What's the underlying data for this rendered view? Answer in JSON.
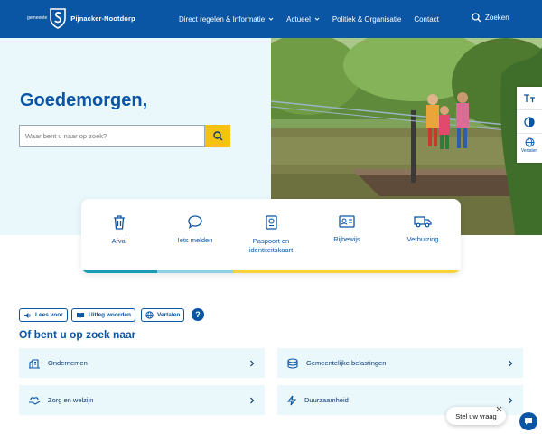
{
  "header": {
    "logo_small": "gemeente",
    "logo_name": "Pijnacker-Nootdorp",
    "nav": [
      {
        "label": "Direct regelen & Informatie",
        "has_dropdown": true
      },
      {
        "label": "Actueel",
        "has_dropdown": true
      },
      {
        "label": "Politiek & Organisatie",
        "has_dropdown": false
      },
      {
        "label": "Contact",
        "has_dropdown": false
      }
    ],
    "search_label": "Zoeken"
  },
  "hero": {
    "greeting": "Goedemorgen,",
    "search_placeholder": "Waar bent u naar op zoek?"
  },
  "tools": {
    "text_size_icon": "text-size-icon",
    "contrast_icon": "contrast-icon",
    "translate_label": "Vertalen"
  },
  "tasks": [
    {
      "label": "Afval",
      "icon": "trash-icon"
    },
    {
      "label": "Iets melden",
      "icon": "speech-bubble-icon"
    },
    {
      "label": "Paspoort en identiteitskaart",
      "icon": "passport-icon"
    },
    {
      "label": "Rijbewijs",
      "icon": "id-card-icon"
    },
    {
      "label": "Verhuizing",
      "icon": "truck-icon"
    }
  ],
  "task_bar_colors": [
    "#1a9db3",
    "#8fd0e6",
    "#f7d23a",
    "#f7d23a"
  ],
  "utilities": {
    "read_aloud": "Lees voor",
    "explain_words": "Uitleg woorden",
    "translate": "Vertalen",
    "help": "?"
  },
  "section_title": "Of bent u op zoek naar",
  "categories": [
    {
      "label": "Ondernemen",
      "icon": "business-icon"
    },
    {
      "label": "Gemeentelijke belastingen",
      "icon": "coins-icon"
    },
    {
      "label": "Zorg en welzijn",
      "icon": "care-icon"
    },
    {
      "label": "Duurzaamheid",
      "icon": "lightning-icon"
    }
  ],
  "chat": {
    "bubble": "Stel uw vraag"
  },
  "colors": {
    "primary": "#0a55a4",
    "accent": "#f7c10f",
    "light_bg": "#eaf8fc"
  }
}
